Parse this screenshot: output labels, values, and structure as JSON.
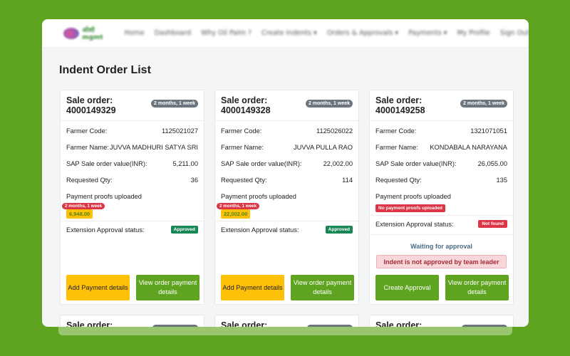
{
  "nav": {
    "logo_text": "ओशो mgmt",
    "items": [
      "Home",
      "Dashboard",
      "Why Oil Palm ?",
      "Create Indents ▾",
      "Orders & Approvals ▾",
      "Payments ▾",
      "My Profile",
      "Sign Out"
    ]
  },
  "page": {
    "title": "Indent Order List"
  },
  "labels": {
    "sale_order": "Sale order:",
    "farmer_code": "Farmer Code:",
    "farmer_name": "Farmer Name:",
    "sap_value": "SAP Sale order value(INR):",
    "requested_qty": "Requested Qty:",
    "payment_proofs": "Payment proofs uploaded",
    "extension_status": "Extension Approval status:"
  },
  "cards": [
    {
      "sale_order": "4000149329",
      "age": "2 months, 1 week",
      "farmer_code": "1125021027",
      "farmer_name": "JUVVA MADHURI SATYA SRI",
      "sap_value": "5,211.00",
      "requested_qty": "36",
      "proof_age": "2 months, 1 week",
      "proof_amount": "6,948.00",
      "extension_status": "Approved",
      "primary_button": "Add Payment details",
      "secondary_button": "View order payment details"
    },
    {
      "sale_order": "4000149328",
      "age": "2 months, 1 week",
      "farmer_code": "1125026022",
      "farmer_name": "JUVVA PULLA RAO",
      "sap_value": "22,002.00",
      "requested_qty": "114",
      "proof_age": "2 months, 1 week",
      "proof_amount": "22,002.00",
      "extension_status": "Approved",
      "primary_button": "Add Payment details",
      "secondary_button": "View order payment details"
    },
    {
      "sale_order": "4000149258",
      "age": "2 months, 1 week",
      "farmer_code": "1321071051",
      "farmer_name": "KONDABALA NARAYANA",
      "sap_value": "26,055.00",
      "requested_qty": "135",
      "no_proofs": "No payment proofs uploaded",
      "extension_status": "Not found",
      "waiting": "Waiting for approval",
      "alert": "Indent is not approved by team leader",
      "primary_button": "Create Approval",
      "secondary_button": "View order payment details"
    }
  ],
  "colors": {
    "brand_green": "#5fa420",
    "warning": "#ffc107",
    "danger": "#dc3545",
    "success": "#198754"
  }
}
